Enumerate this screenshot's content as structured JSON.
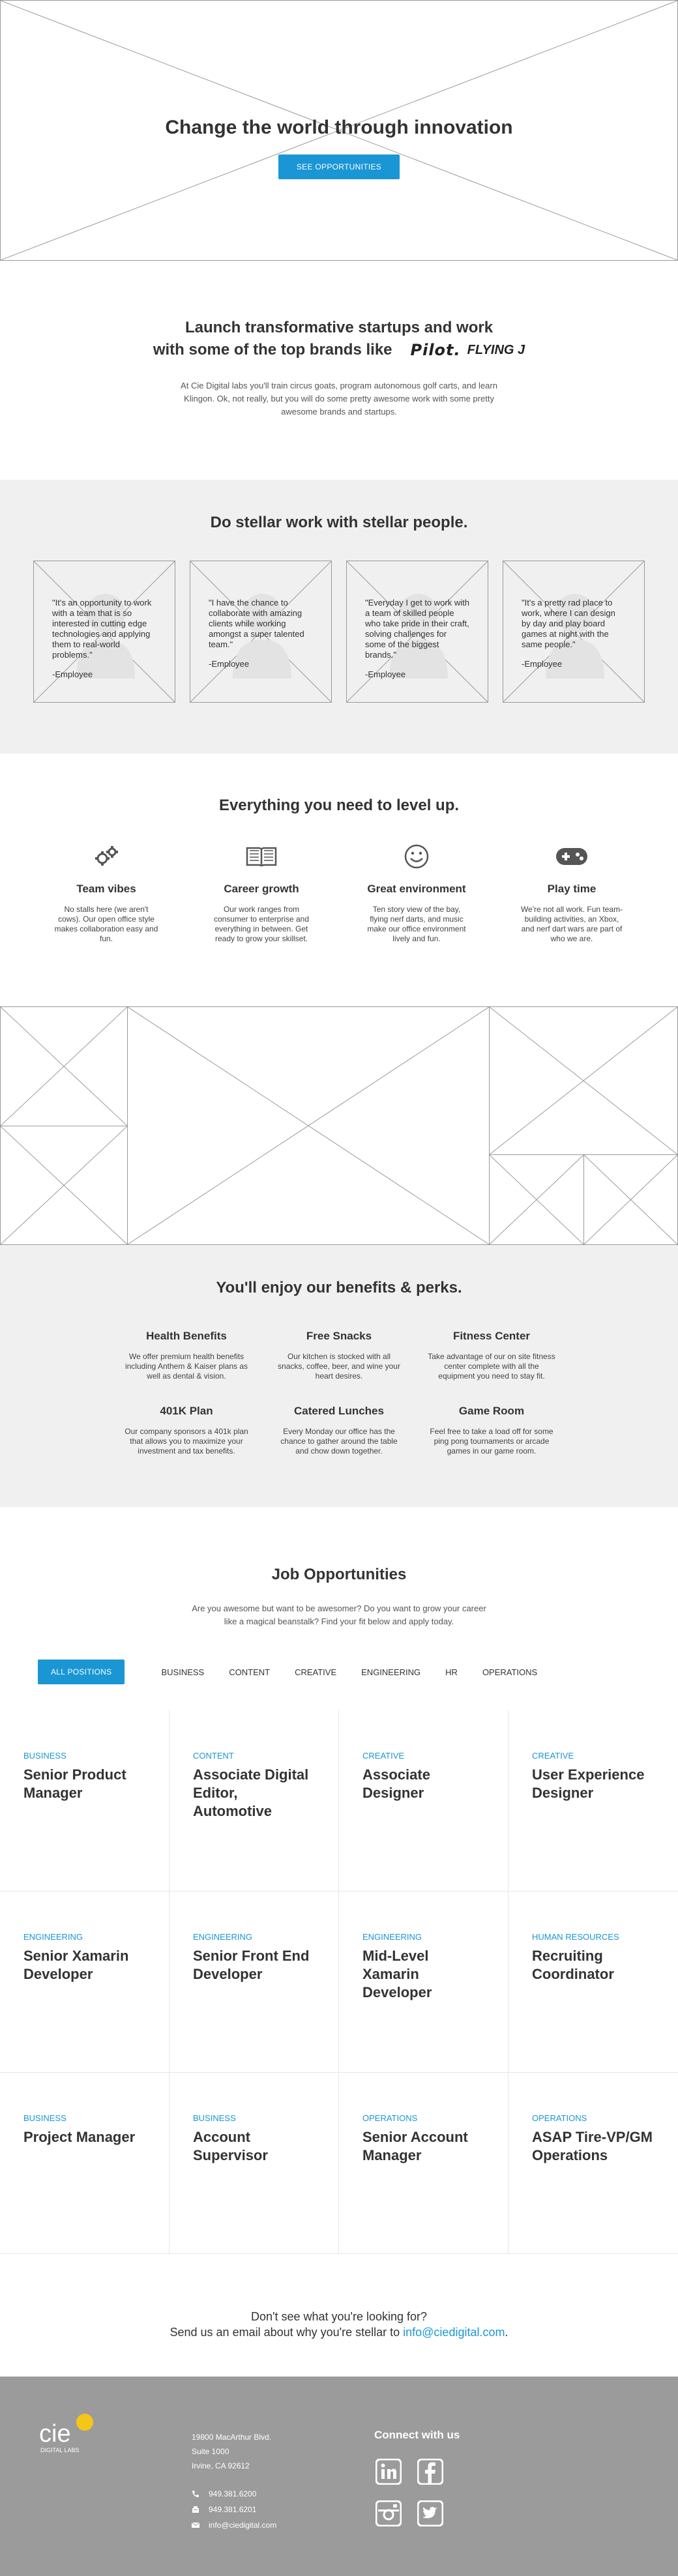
{
  "hero": {
    "title": "Change the world through innovation",
    "button": "SEE OPPORTUNITIES"
  },
  "launch": {
    "line1": "Launch transformative startups and work",
    "line2": "with some of the top brands like",
    "brands": [
      "Pilot.",
      "FLYING J"
    ],
    "body": "At Cie Digital labs you'll train circus goats, program autonomous golf carts, and learn Klingon. Ok, not really, but you will do some pretty awesome work with some pretty awesome brands and startups."
  },
  "stellar": {
    "title": "Do stellar work with stellar people.",
    "quotes": [
      {
        "text": "\"It's an opportunity to work with a team that is so interested in cutting edge technologies and applying them to real-world problems.\"",
        "who": "-Employee"
      },
      {
        "text": "\"I have the chance to collaborate with amazing clients while working amongst a super talented team.\"",
        "who": "-Employee"
      },
      {
        "text": "\"Everyday I get to work with a team of skilled people who take pride in their craft, solving challenges for some of the biggest brands.\"",
        "who": "-Employee"
      },
      {
        "text": "\"It's a pretty rad place to work, where I can design by day and play board games at night with the same people.\"",
        "who": "-Employee"
      }
    ]
  },
  "levelup": {
    "title": "Everything you need to level up.",
    "features": [
      {
        "icon": "gears-icon",
        "title": "Team vibes",
        "text": "No stalls here (we aren't cows). Our open office style makes collaboration easy and fun."
      },
      {
        "icon": "book-icon",
        "title": "Career growth",
        "text": "Our work ranges from consumer to enterprise and everything in between. Get ready to grow your skillset."
      },
      {
        "icon": "smiley-icon",
        "title": "Great environment",
        "text": "Ten story view of the bay, flying nerf darts, and music make our office environment lively and fun."
      },
      {
        "icon": "gamepad-icon",
        "title": "Play time",
        "text": "We're not all work. Fun team-building activities, an Xbox, and nerf dart wars are part of who we are."
      }
    ]
  },
  "perks": {
    "title": "You'll enjoy our benefits & perks.",
    "items": [
      {
        "title": "Health Benefits",
        "text": "We offer premium health benefits including Anthem & Kaiser plans as well as dental & vision."
      },
      {
        "title": "Free Snacks",
        "text": "Our kitchen is stocked with all snacks, coffee, beer, and wine your heart desires."
      },
      {
        "title": "Fitness Center",
        "text": "Take advantage of our on site fitness center complete with all the equipment you need to stay fit."
      },
      {
        "title": "401K Plan",
        "text": "Our company sponsors a 401k plan that allows you to maximize your investment and tax benefits."
      },
      {
        "title": "Catered Lunches",
        "text": "Every Monday our office has the chance to gather around the table and chow down together."
      },
      {
        "title": "Game Room",
        "text": "Feel free to take a load off for some ping pong tournaments or arcade games in our game room."
      }
    ]
  },
  "jobs": {
    "title": "Job Opportunities",
    "intro": "Are you awesome but want to be awesomer? Do you want to grow your career like a magical beanstalk? Find your fit below and apply today.",
    "filter_all": "ALL POSITIONS",
    "filters": [
      "BUSINESS",
      "CONTENT",
      "CREATIVE",
      "ENGINEERING",
      "HR",
      "OPERATIONS"
    ],
    "listings": [
      {
        "category": "BUSINESS",
        "title": "Senior Product Manager"
      },
      {
        "category": "CONTENT",
        "title": "Associate Digital Editor, Automotive"
      },
      {
        "category": "CREATIVE",
        "title": "Associate Designer"
      },
      {
        "category": "CREATIVE",
        "title": "User Experience Designer"
      },
      {
        "category": "ENGINEERING",
        "title": "Senior Xamarin Developer"
      },
      {
        "category": "ENGINEERING",
        "title": "Senior Front End Developer"
      },
      {
        "category": "ENGINEERING",
        "title": "Mid-Level Xamarin Developer"
      },
      {
        "category": "HUMAN RESOURCES",
        "title": "Recruiting Coordinator"
      },
      {
        "category": "BUSINESS",
        "title": "Project Manager"
      },
      {
        "category": "BUSINESS",
        "title": "Account Supervisor"
      },
      {
        "category": "OPERATIONS",
        "title": "Senior Account Manager"
      },
      {
        "category": "OPERATIONS",
        "title": "ASAP Tire-VP/GM Operations"
      }
    ]
  },
  "contact": {
    "line1": "Don't see what you're looking for?",
    "line2": "Send us an email about why you're stellar to ",
    "email": "info@ciedigital.com",
    "period": "."
  },
  "footer": {
    "logo_text": "cie",
    "logo_sub": "DIGITAL LABS",
    "brand_color": "#f5c518",
    "address": [
      "19800 MacArthur Blvd.",
      "Suite 1000",
      "Irvine, CA 92612"
    ],
    "phone": "949.381.6200",
    "fax": "949.381.6201",
    "email": "info@ciedigital.com",
    "connect_title": "Connect with us",
    "socials": [
      "linkedin-icon",
      "facebook-icon",
      "instagram-icon",
      "twitter-icon"
    ]
  },
  "colors": {
    "accent": "#1a96d4",
    "section_bg": "#f0f0f0",
    "footer_bg": "#9b9b9b"
  }
}
